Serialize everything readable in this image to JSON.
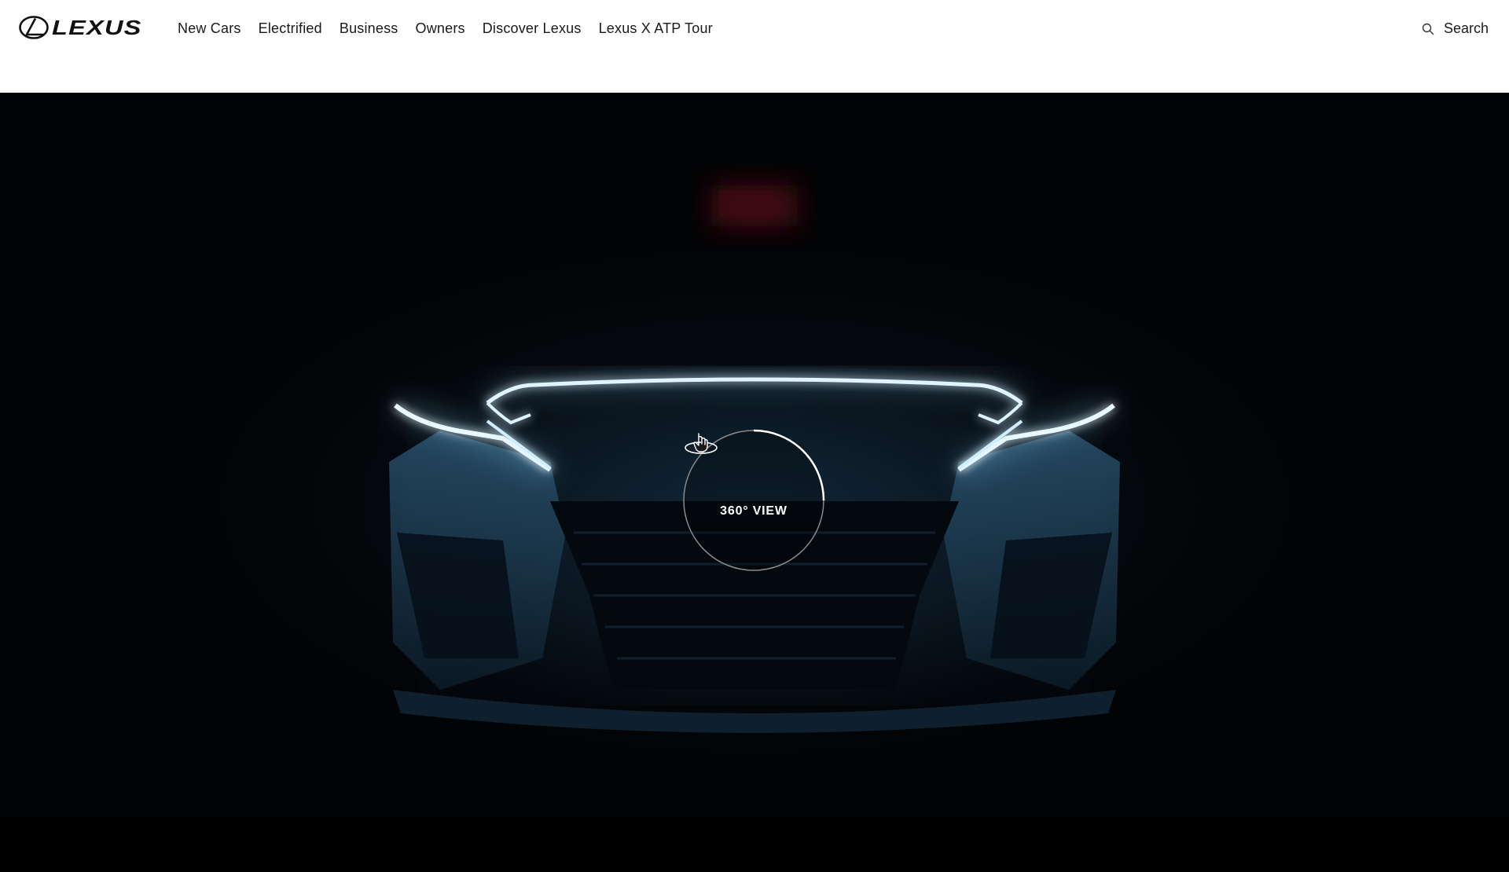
{
  "header": {
    "logo_text": "LEXUS",
    "nav": [
      {
        "label": "New Cars"
      },
      {
        "label": "Electrified"
      },
      {
        "label": "Business"
      },
      {
        "label": "Owners"
      },
      {
        "label": "Discover Lexus"
      },
      {
        "label": "Lexus X ATP Tour"
      }
    ],
    "search_label": "Search",
    "search_icon": "search-icon"
  },
  "hero": {
    "view_button_label": "360° VIEW",
    "view_button_icon": "hand-rotate-icon",
    "accent_color": "#8fd4ff"
  }
}
